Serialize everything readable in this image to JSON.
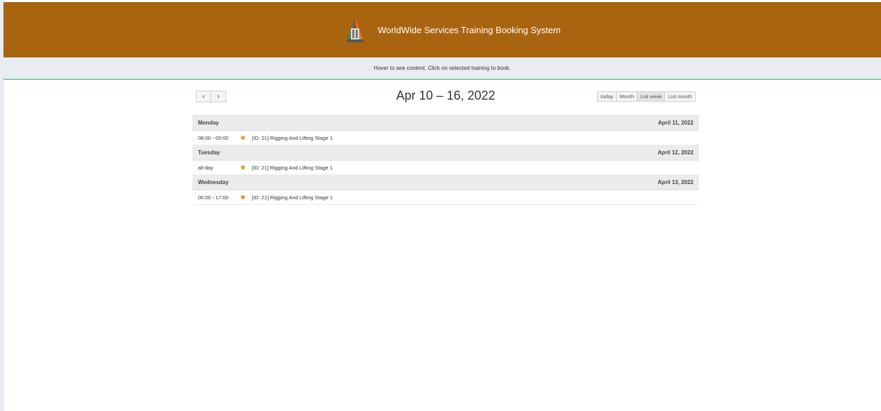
{
  "header": {
    "title": "WorldWide Services Training Booking System"
  },
  "info_bar": {
    "text": "Hover to see content. Click on selected training to book."
  },
  "calendar": {
    "range_title": "Apr 10 – 16, 2022",
    "nav": {
      "prev": "‹",
      "next": "›"
    },
    "views": {
      "today": "today",
      "month": "Month",
      "list_week": "List week",
      "list_month": "List month"
    },
    "active_view": "List week",
    "event_color": "#e8a030",
    "days": [
      {
        "name": "Monday",
        "date": "April 11, 2022",
        "events": [
          {
            "time": "08:00 - 00:00",
            "title": "[ID: 21] Rigging And Lifting Stage 1"
          }
        ]
      },
      {
        "name": "Tuesday",
        "date": "April 12, 2022",
        "events": [
          {
            "time": "all-day",
            "title": "[ID: 21] Rigging And Lifting Stage 1"
          }
        ]
      },
      {
        "name": "Wednesday",
        "date": "April 13, 2022",
        "events": [
          {
            "time": "00:00 - 17:00",
            "title": "[ID: 21] Rigging And Lifting Stage 1"
          }
        ]
      }
    ]
  },
  "colors": {
    "header_bg": "#a9640f",
    "info_bar_bg": "#e9edf2",
    "info_bar_border": "#3a9a6a"
  }
}
